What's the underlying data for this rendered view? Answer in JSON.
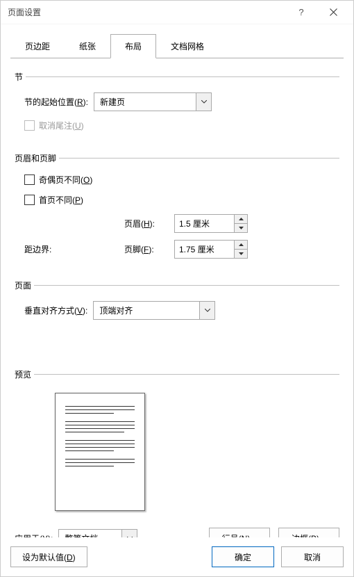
{
  "title": "页面设置",
  "tabs": {
    "t0": "页边距",
    "t1": "纸张",
    "t2": "布局",
    "t3": "文档网格"
  },
  "section": {
    "title": "节",
    "start_label_pre": "节的起始位置(",
    "start_label_u": "R",
    "start_label_post": "):",
    "start_value": "新建页",
    "suppress_pre": "取消尾注(",
    "suppress_u": "U",
    "suppress_post": ")"
  },
  "hf": {
    "title": "页眉和页脚",
    "odd_pre": "奇偶页不同(",
    "odd_u": "O",
    "odd_post": ")",
    "first_pre": "首页不同(",
    "first_u": "P",
    "first_post": ")",
    "margin_label": "距边界:",
    "header_pre": "页眉(",
    "header_u": "H",
    "header_post": "):",
    "header_value": "1.5 厘米",
    "footer_pre": "页脚(",
    "footer_u": "F",
    "footer_post": "):",
    "footer_value": "1.75 厘米"
  },
  "page": {
    "title": "页面",
    "valign_pre": "垂直对齐方式(",
    "valign_u": "V",
    "valign_post": "):",
    "valign_value": "顶端对齐"
  },
  "preview": {
    "title": "预览"
  },
  "apply": {
    "pre": "应用于(",
    "u": "Y",
    "post": "):",
    "value": "整篇文档",
    "line_pre": "行号(",
    "line_u": "N",
    "line_post": ")...",
    "border_pre": "边框(",
    "border_u": "B",
    "border_post": ")..."
  },
  "footer_btns": {
    "default_pre": "设为默认值(",
    "default_u": "D",
    "default_post": ")",
    "ok": "确定",
    "cancel": "取消"
  }
}
